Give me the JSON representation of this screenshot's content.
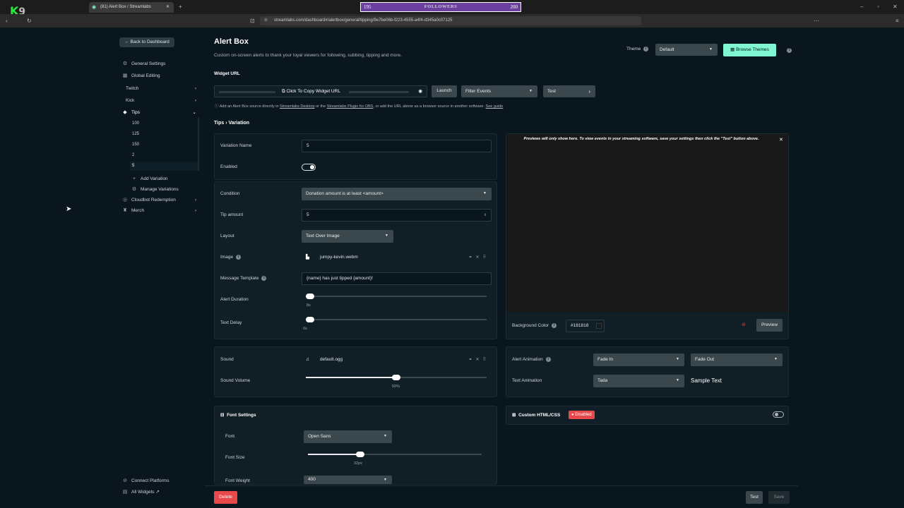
{
  "overlay": {
    "channel_mark": "K",
    "channel_num": "9",
    "followers_label": "FOLLOWERS",
    "followers_current": "195",
    "followers_goal": "200"
  },
  "browser": {
    "tab_title": "(81) Alert Box / Streamlabs",
    "url": "streamlabs.com/dashboard#/alertbox/general/tipping/9e7be06b-f223-4555-a4f4-d345a0c07125"
  },
  "sidebar": {
    "back_label": "Back to Dashboard",
    "items": [
      {
        "label": "General Settings"
      },
      {
        "label": "Global Editing"
      },
      {
        "label": "Twitch"
      },
      {
        "label": "Kick"
      },
      {
        "label": "Tips"
      }
    ],
    "variations": [
      "100",
      "125",
      "150",
      "2",
      "5"
    ],
    "add_variation": "Add Variation",
    "manage_variations": "Manage Variations",
    "extra": [
      {
        "label": "Cloudbot Redemption"
      },
      {
        "label": "Merch"
      }
    ],
    "connect_platforms": "Connect Platforms",
    "all_widgets": "All Widgets"
  },
  "header": {
    "title": "Alert Box",
    "subtitle": "Custom on-screen alerts to thank your loyal viewers for following, subbing, tipping and more.",
    "theme_label": "Theme",
    "theme_value": "Default",
    "browse_themes": "Browse Themes"
  },
  "widget_url": {
    "label": "Widget URL",
    "copy_label": "Click To Copy Widget URL",
    "launch": "Launch",
    "filter_events": "Filter Events",
    "test": "Test",
    "hint_prefix": "Add an Alert Box source directly in",
    "hint_link1": "Streamlabs Desktop",
    "hint_mid": "or the",
    "hint_link2": "Streamlabs Plugin for OBS",
    "hint_suffix": ", or add the URL above as a browser source in another software.",
    "hint_link3": "See guide"
  },
  "breadcrumb": {
    "parent": "Tips",
    "sep": "›",
    "current": "Variation"
  },
  "form": {
    "variation_name_label": "Variation Name",
    "variation_name": "5",
    "enabled_label": "Enabled",
    "condition_label": "Condition",
    "condition_value": "Donation amount is at least <amount>",
    "tip_amount_label": "Tip amount",
    "tip_amount": "5",
    "layout_label": "Layout",
    "layout_value": "Text Over Image",
    "image_label": "Image",
    "image_file": "jumpy-kevin.webm",
    "message_label": "Message Template",
    "message_value": "{name} has just tipped {amount}!",
    "alert_duration_label": "Alert Duration",
    "alert_duration": "8s",
    "alert_duration_level": 0.02,
    "text_delay_label": "Text Delay",
    "text_delay": "0s",
    "text_delay_level": 0.0
  },
  "sound": {
    "sound_label": "Sound",
    "sound_file": "default.ogg",
    "volume_label": "Sound Volume",
    "volume": "50%",
    "volume_level": 0.5
  },
  "font": {
    "section_label": "Font Settings",
    "font_label": "Font",
    "font_value": "Open Sans",
    "size_label": "Font Size",
    "size_value": "32px",
    "size_level": 0.3,
    "weight_label": "Font Weight",
    "weight_value": "400"
  },
  "preview": {
    "notice": "Previews will only show here. To view events in your streaming software, save your settings then click the \"Test\" button above.",
    "bg_label": "Background Color",
    "bg_value": "#181818",
    "preview_btn": "Preview"
  },
  "animation": {
    "alert_label": "Alert Animation",
    "in_value": "Fade In",
    "out_value": "Fade Out",
    "text_label": "Text Animation",
    "text_value": "Tada",
    "sample": "Sample Text"
  },
  "custom": {
    "label": "Custom HTML/CSS",
    "badge": "Disabled"
  },
  "footer": {
    "delete": "Delete",
    "test": "Test",
    "save": "Save"
  },
  "colors": {
    "accent": "#80f5d2",
    "danger": "#e6484b",
    "overlay_purple": "#6b3fa0",
    "bg": "#09161d",
    "panel": "#101e25"
  }
}
